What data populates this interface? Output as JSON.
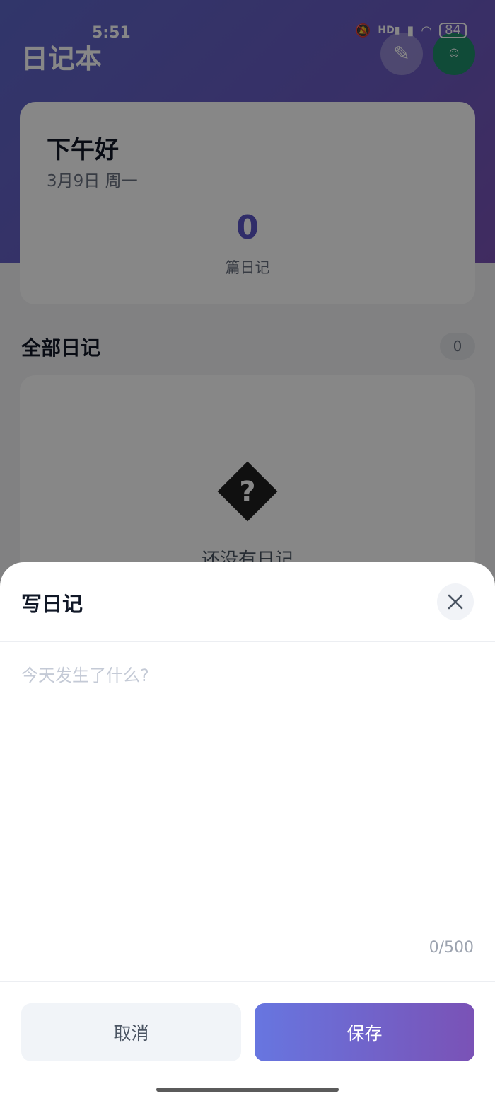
{
  "status_bar": {
    "time": "5:51",
    "battery": "84",
    "icons": [
      "mute-icon",
      "hd-signal-icon",
      "signal-icon",
      "wifi-icon",
      "battery-icon"
    ]
  },
  "header": {
    "title": "日记本",
    "edit_icon": "pencil-icon",
    "avatar_icon": "avatar"
  },
  "summary": {
    "greeting": "下午好",
    "date": "3月9日 周一",
    "count": "0",
    "count_label": "篇日记"
  },
  "section": {
    "title": "全部日记",
    "badge": "0"
  },
  "empty_state": {
    "icon": "question-diamond-icon",
    "text": "还没有日记"
  },
  "sheet": {
    "title": "写日记",
    "close_icon": "close-icon",
    "input_value": "",
    "input_placeholder": "今天发生了什么?",
    "char_count": "0/500",
    "cancel_label": "取消",
    "save_label": "保存"
  },
  "colors": {
    "brand_start": "#6776e0",
    "brand_end": "#7a52b6",
    "count_accent": "#5b55c6"
  }
}
